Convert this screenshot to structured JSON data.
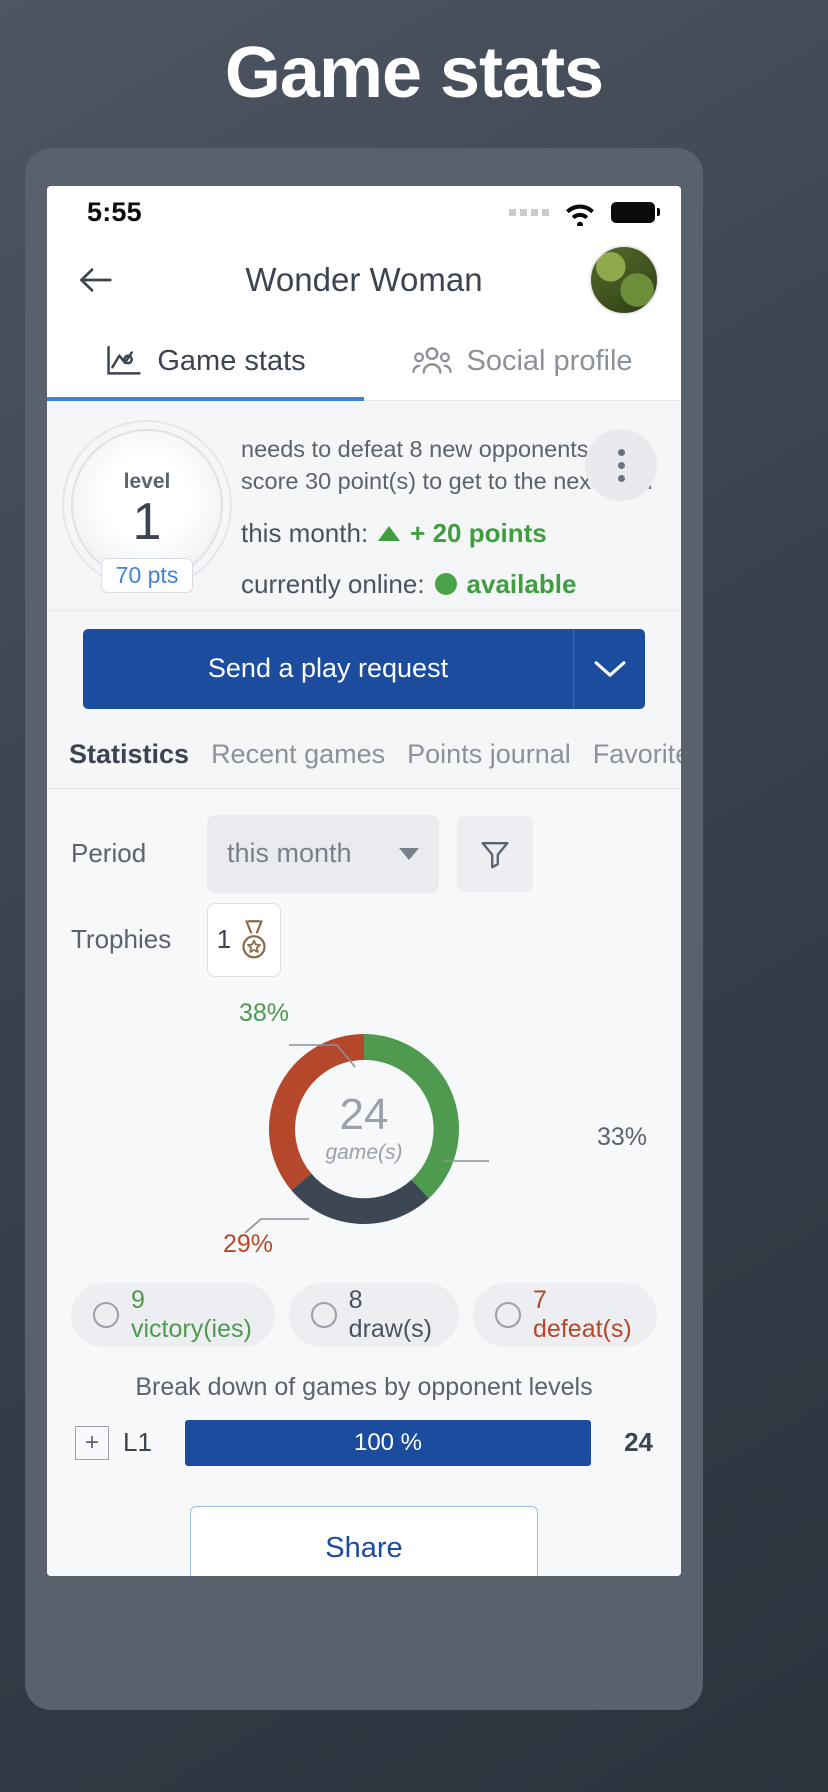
{
  "page": {
    "title": "Game stats"
  },
  "status_bar": {
    "time": "5:55",
    "wifi_icon": "wifi-icon",
    "battery_icon": "battery-full-icon"
  },
  "nav": {
    "back_icon": "arrow-left-icon",
    "title": "Wonder Woman",
    "avatar": "user-avatar"
  },
  "tabs": [
    {
      "label": "Game stats",
      "icon": "chart-line-icon",
      "active": true
    },
    {
      "label": "Social profile",
      "icon": "people-group-icon",
      "active": false
    }
  ],
  "profile": {
    "level_word": "level",
    "level_number": "1",
    "points_badge": "70 pts",
    "needs_text": "needs to defeat 8 new opponents and score 30 point(s) to get to the next level",
    "month_label": "this month:",
    "month_value": "+ 20 points",
    "online_label": "currently online:",
    "online_value": "available",
    "menu_icon": "kebab-menu-icon"
  },
  "cta": {
    "label": "Send a play request",
    "caret_icon": "chevron-down-icon"
  },
  "subtabs": [
    {
      "label": "Statistics",
      "active": true
    },
    {
      "label": "Recent games",
      "active": false
    },
    {
      "label": "Points journal",
      "active": false
    },
    {
      "label": "Favorite ga",
      "active": false
    }
  ],
  "filters": {
    "period_label": "Period",
    "period_value": "this month",
    "filter_icon": "funnel-icon",
    "trophies_label": "Trophies",
    "trophies_count": "1",
    "trophy_icon": "medal-icon"
  },
  "chart_data": {
    "type": "pie",
    "title": "",
    "center_value": "24",
    "center_sub": "game(s)",
    "categories": [
      "victory(ies)",
      "draw(s)",
      "defeat(s)"
    ],
    "values": [
      9,
      8,
      7
    ],
    "percents": [
      "38%",
      "33%",
      "29%"
    ],
    "colors": [
      "#4e9a4e",
      "#3d4753",
      "#b5472a"
    ],
    "legend_position": "bottom"
  },
  "legend": [
    {
      "label": "9 victory(ies)"
    },
    {
      "label": "8 draw(s)"
    },
    {
      "label": "7 defeat(s)"
    }
  ],
  "breakdown": {
    "title": "Break down of games by opponent levels",
    "expand_icon": "plus-box-icon",
    "rows": [
      {
        "name": "L1",
        "percent_label": "100 %",
        "count": "24"
      }
    ]
  },
  "share": {
    "label": "Share"
  }
}
